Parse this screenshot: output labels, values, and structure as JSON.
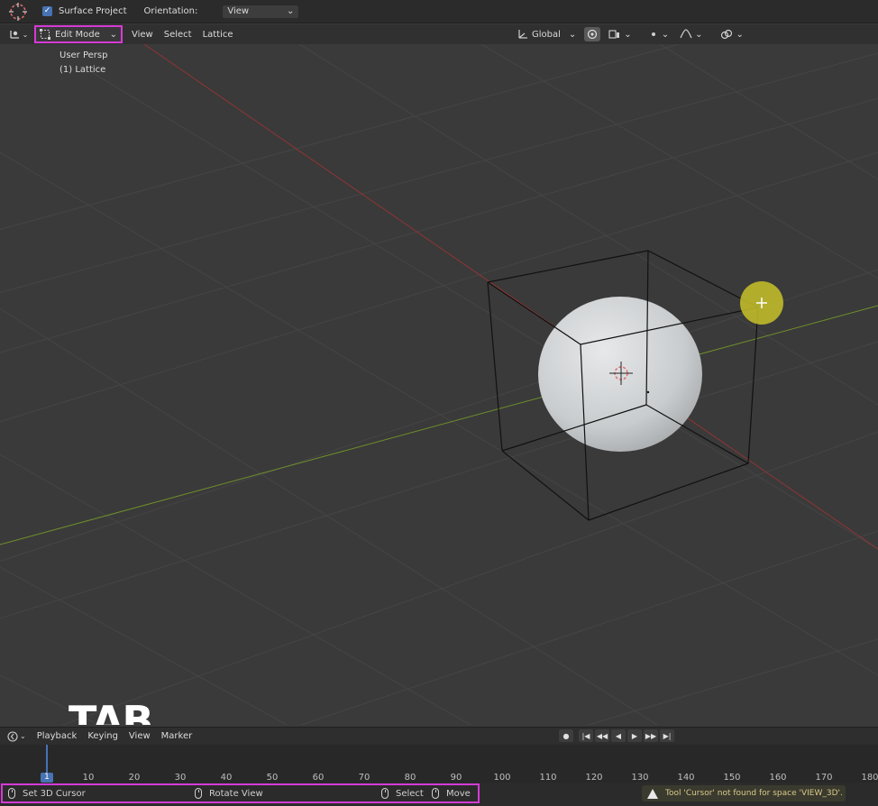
{
  "tool_settings": {
    "surface_project_checked": "✓",
    "surface_project_label": "Surface Project",
    "orientation_label": "Orientation:",
    "orientation_value": "View",
    "orientation_chevron": "⌄"
  },
  "header": {
    "mode_value": "Edit Mode",
    "mode_chevron": "⌄",
    "menus": [
      "View",
      "Select",
      "Lattice"
    ],
    "transform_orientation": "Global",
    "chevron": "⌄"
  },
  "viewport": {
    "view_name": "User Persp",
    "object_name": "(1) Lattice",
    "overlay_text": "TAB"
  },
  "timeline": {
    "menus": [
      "Playback",
      "Keying",
      "View",
      "Marker"
    ],
    "current_frame": "1",
    "frames": [
      "10",
      "20",
      "30",
      "40",
      "50",
      "60",
      "70",
      "80",
      "90",
      "100",
      "110",
      "120",
      "130",
      "140",
      "150",
      "160",
      "170",
      "180"
    ],
    "playback_buttons": [
      "●",
      "|◀",
      "◀◀",
      "◀",
      "▶",
      "▶▶",
      "▶|"
    ]
  },
  "statusbar": {
    "hint_set_cursor": "Set 3D Cursor",
    "hint_rotate": "Rotate View",
    "hint_select": "Select",
    "hint_move": "Move",
    "warning": "Tool 'Cursor' not found for space 'VIEW_3D'."
  },
  "colors": {
    "accent_highlight": "#d63ad6",
    "x_axis": "#a03a3a",
    "y_axis": "#6f8f2a",
    "click_indicator": "#c8c229",
    "active_blue": "#4772b3"
  }
}
